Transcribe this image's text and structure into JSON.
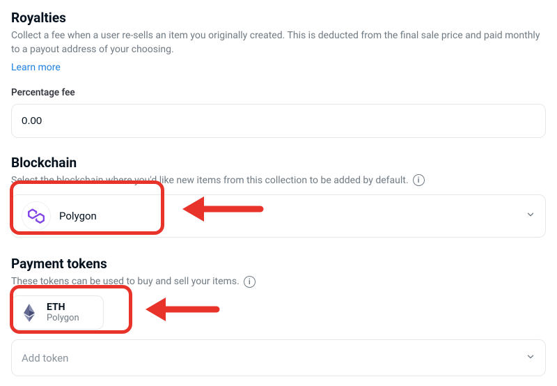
{
  "royalties": {
    "title": "Royalties",
    "description": "Collect a fee when a user re-sells an item you originally created. This is deducted from the final sale price and paid monthly to a payout address of your choosing.",
    "learn_more": "Learn more",
    "fee_label": "Percentage fee",
    "fee_value": "0.00"
  },
  "blockchain": {
    "title": "Blockchain",
    "description": "Select the blockchain where you'd like new items from this collection to be added by default.",
    "selected": "Polygon",
    "icon_name": "polygon-icon"
  },
  "payment_tokens": {
    "title": "Payment tokens",
    "description": "These tokens can be used to buy and sell your items.",
    "tokens": [
      {
        "symbol": "ETH",
        "network": "Polygon",
        "icon_name": "eth-icon"
      }
    ],
    "add_placeholder": "Add token"
  },
  "colors": {
    "accent": "#2081e2",
    "annotation": "#e8332b"
  }
}
